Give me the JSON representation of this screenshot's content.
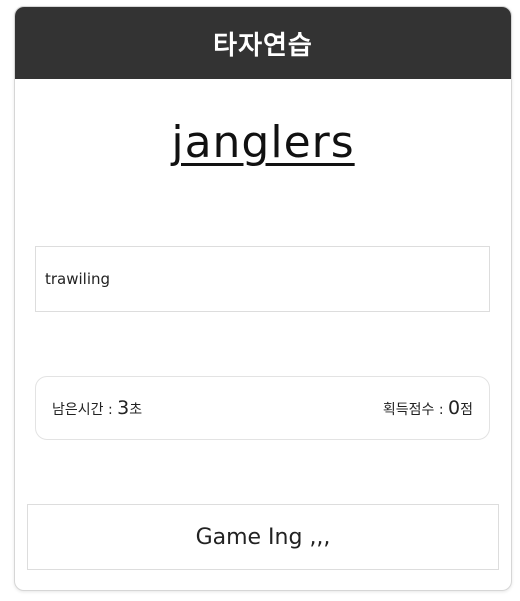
{
  "header": {
    "title": "타자연습"
  },
  "game": {
    "target_word": "janglers",
    "input_value": "trawiling",
    "time_label": "남은시간 : ",
    "time_value": "3",
    "time_unit": "초",
    "score_label": "획득점수 : ",
    "score_value": "0",
    "score_unit": "점",
    "button_label": "Game Ing ,,,"
  },
  "colors": {
    "header_bg": "#333333",
    "header_text": "#ffffff",
    "border": "#dddddd"
  }
}
